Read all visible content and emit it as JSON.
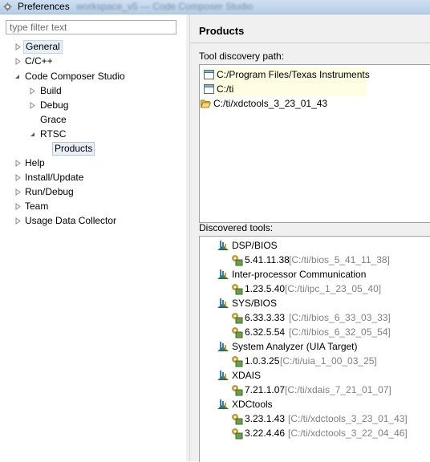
{
  "window": {
    "title": "Preferences",
    "blurred_title": "workspace_v5 — Code Composer Studio"
  },
  "sidebar": {
    "filter_placeholder": "type filter text",
    "items": [
      {
        "label": "General"
      },
      {
        "label": "C/C++"
      },
      {
        "label": "Code Composer Studio"
      },
      {
        "label": "Build"
      },
      {
        "label": "Debug"
      },
      {
        "label": "Grace"
      },
      {
        "label": "RTSC"
      },
      {
        "label": "Products"
      },
      {
        "label": "Help"
      },
      {
        "label": "Install/Update"
      },
      {
        "label": "Run/Debug"
      },
      {
        "label": "Team"
      },
      {
        "label": "Usage Data Collector"
      }
    ]
  },
  "main": {
    "title": "Products",
    "discovery_label": "Tool discovery path:",
    "discovery_paths": [
      {
        "path": "C:/Program Files/Texas Instruments",
        "icon": "folder-checkbox-icon"
      },
      {
        "path": "C:/ti",
        "icon": "folder-checkbox-icon"
      },
      {
        "path": "C:/ti/xdctools_3_23_01_43",
        "icon": "open-folder-icon"
      }
    ],
    "discovered_label": "Discovered tools:",
    "tools": [
      {
        "name": "DSP/BIOS",
        "versions": [
          {
            "version": "5.41.11.38",
            "path": "[C:/ti/bios_5_41_11_38]"
          }
        ]
      },
      {
        "name": "Inter-processor Communication",
        "versions": [
          {
            "version": "1.23.5.40",
            "path": "[C:/ti/ipc_1_23_05_40]"
          }
        ]
      },
      {
        "name": "SYS/BIOS",
        "versions": [
          {
            "version": "6.33.3.33",
            "path": "[C:/ti/bios_6_33_03_33]"
          },
          {
            "version": "6.32.5.54",
            "path": "[C:/ti/bios_6_32_05_54]"
          }
        ]
      },
      {
        "name": "System Analyzer (UIA Target)",
        "versions": [
          {
            "version": "1.0.3.25",
            "path": "[C:/ti/uia_1_00_03_25]"
          }
        ]
      },
      {
        "name": "XDAIS",
        "versions": [
          {
            "version": "7.21.1.07",
            "path": "[C:/ti/xdais_7_21_01_07]"
          }
        ]
      },
      {
        "name": "XDCtools",
        "versions": [
          {
            "version": "3.23.1.43",
            "path": "[C:/ti/xdctools_3_23_01_43]"
          },
          {
            "version": "3.22.4.46",
            "path": "[C:/ti/xdctools_3_22_04_46]"
          }
        ]
      }
    ]
  }
}
